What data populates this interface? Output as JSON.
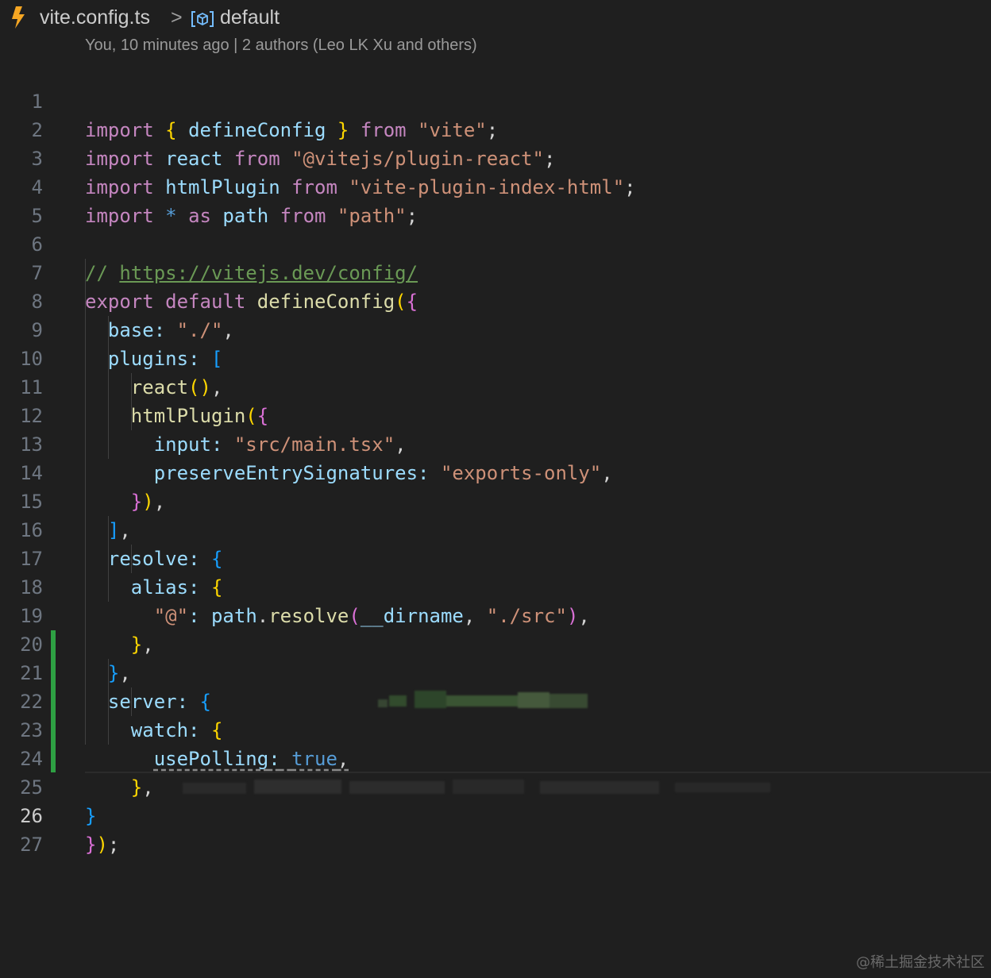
{
  "breadcrumb": {
    "file": "vite.config.ts",
    "separator": ">",
    "item": "default",
    "file_icon": "vite-bolt-icon",
    "symbol_icon": "symbol-variable-icon"
  },
  "blame": "You, 10 minutes ago | 2 authors (Leo LK Xu and others)",
  "line_numbers": [
    "1",
    "2",
    "3",
    "4",
    "5",
    "6",
    "7",
    "8",
    "9",
    "10",
    "11",
    "12",
    "13",
    "14",
    "15",
    "16",
    "17",
    "18",
    "19",
    "20",
    "21",
    "22",
    "23",
    "24",
    "25",
    "26",
    "27"
  ],
  "active_line": "26",
  "code": {
    "l1": {
      "k1": "import",
      "b1": "{",
      "f": "defineConfig",
      "b2": "}",
      "k2": "from",
      "s": "\"vite\"",
      "p": ";"
    },
    "l2": {
      "k1": "import",
      "v": "react",
      "k2": "from",
      "s": "\"@vitejs/plugin-react\"",
      "p": ";"
    },
    "l3": {
      "k1": "import",
      "v": "htmlPlugin",
      "k2": "from",
      "s": "\"vite-plugin-index-html\"",
      "p": ";"
    },
    "l4": {
      "k1": "import",
      "star": "*",
      "k2": "as",
      "v": "path",
      "k3": "from",
      "s": "\"path\"",
      "p": ";"
    },
    "l6": {
      "c": "//",
      "url": "https://vitejs.dev/config/"
    },
    "l7": {
      "k1": "export",
      "k2": "default",
      "f": "defineConfig",
      "b1": "(",
      "b2": "{"
    },
    "l8": {
      "v": "base",
      "p1": ":",
      "s": "\"./\"",
      "p2": ","
    },
    "l9": {
      "v": "plugins",
      "p1": ":",
      "b": "["
    },
    "l10": {
      "f": "react",
      "b": "()",
      "p": ","
    },
    "l11": {
      "f": "htmlPlugin",
      "b1": "(",
      "b2": "{"
    },
    "l12": {
      "v": "input",
      "p1": ":",
      "s": "\"src/main.tsx\"",
      "p2": ","
    },
    "l13": {
      "v": "preserveEntrySignatures",
      "p1": ":",
      "s": "\"exports-only\"",
      "p2": ","
    },
    "l14": {
      "b1": "}",
      "b2": ")",
      "p": ","
    },
    "l15": {
      "b": "]",
      "p": ","
    },
    "l16": {
      "v": "resolve",
      "p1": ":",
      "b": "{"
    },
    "l17": {
      "v": "alias",
      "p1": ":",
      "b": "{"
    },
    "l18": {
      "s1": "\"@\"",
      "p1": ":",
      "v1": "path",
      "p2": ".",
      "f": "resolve",
      "b1": "(",
      "v2": "__dirname",
      "p3": ",",
      "s2": "\"./src\"",
      "b2": ")",
      "p4": ","
    },
    "l19": {
      "b": "}",
      "p": ","
    },
    "l20": {
      "b": "}",
      "p": ","
    },
    "l21": {
      "v": "server",
      "p1": ":",
      "b": "{"
    },
    "l22": {
      "v": "watch",
      "p1": ":",
      "b": "{"
    },
    "l23": {
      "v": "usePolling",
      "p1": ":",
      "t": "true",
      "p2": ","
    },
    "l24": {
      "b": "}",
      "p": ","
    },
    "l25": {
      "b": "}"
    },
    "l26": {
      "b1": "}",
      "b2": ")",
      "p": ";"
    }
  },
  "watermark": "@稀土掘金技术社区",
  "colors": {
    "background": "#1f1f1f",
    "keyword": "#c586c0",
    "function": "#dcdcaa",
    "variable": "#9cdcfe",
    "string": "#ce9178",
    "comment": "#6a9955",
    "git_added": "#2ea043"
  }
}
